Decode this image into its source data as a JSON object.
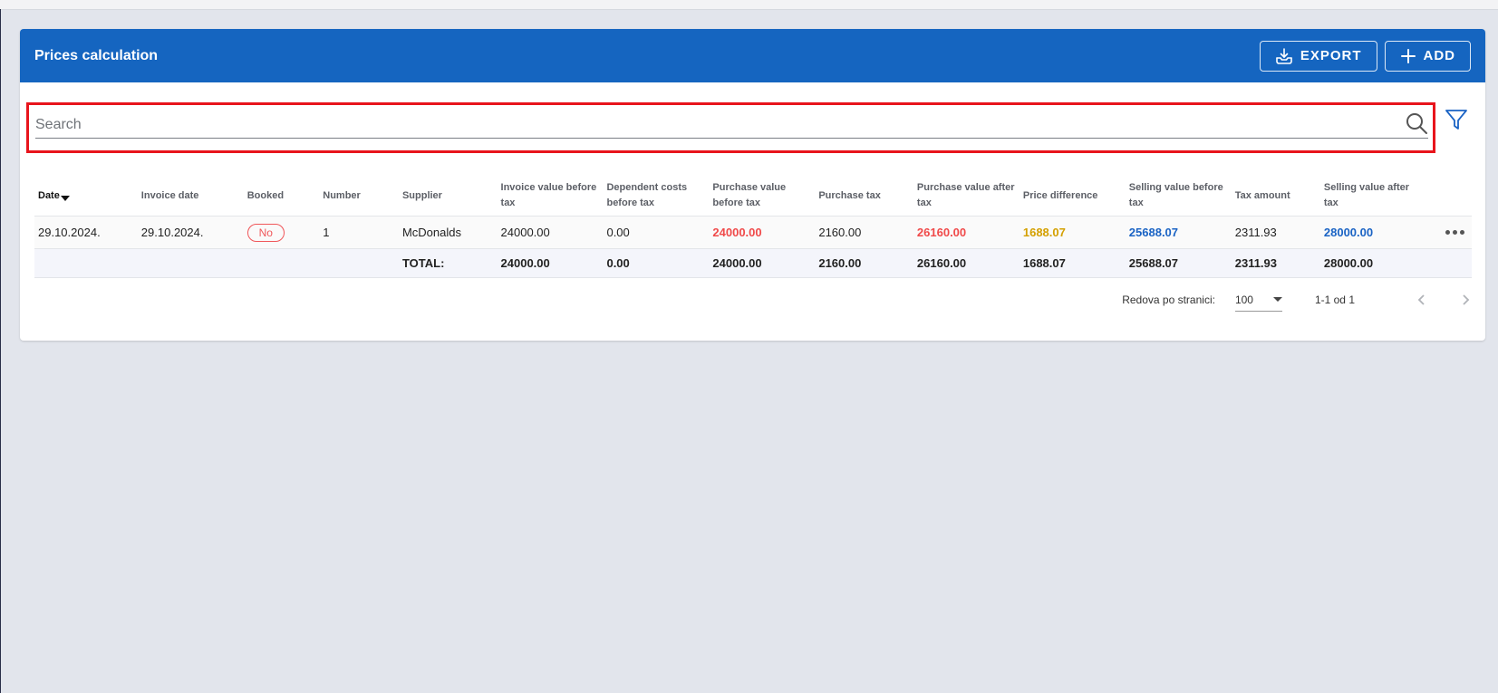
{
  "header": {
    "title": "Prices calculation",
    "export_label": "EXPORT",
    "add_label": "ADD"
  },
  "search": {
    "placeholder": "Search",
    "value": ""
  },
  "icons": {
    "export": "download-icon",
    "add": "plus-icon",
    "search": "search-icon",
    "filter": "filter-icon",
    "row_menu": "more-horizontal-icon",
    "prev": "chevron-left-icon",
    "next": "chevron-right-icon"
  },
  "colors": {
    "header_bg": "#1565c0",
    "negative": "#f04a4a",
    "difference": "#d4a000",
    "selling": "#1a63c4",
    "highlight_border": "#e8141c"
  },
  "table": {
    "columns": [
      "Date",
      "Invoice date",
      "Booked",
      "Number",
      "Supplier",
      "Invoice value before tax",
      "Dependent costs before tax",
      "Purchase value before tax",
      "Purchase tax",
      "Purchase value after tax",
      "Price difference",
      "Selling value before tax",
      "Tax amount",
      "Selling value after tax"
    ],
    "rows": [
      {
        "date": "29.10.2024.",
        "invoice_date": "29.10.2024.",
        "booked": "No",
        "number": "1",
        "supplier": "McDonalds",
        "invoice_value_before_tax": "24000.00",
        "dependent_costs_before_tax": "0.00",
        "purchase_value_before_tax": "24000.00",
        "purchase_tax": "2160.00",
        "purchase_value_after_tax": "26160.00",
        "price_difference": "1688.07",
        "selling_value_before_tax": "25688.07",
        "tax_amount": "2311.93",
        "selling_value_after_tax": "28000.00"
      }
    ],
    "total": {
      "label": "TOTAL:",
      "invoice_value_before_tax": "24000.00",
      "dependent_costs_before_tax": "0.00",
      "purchase_value_before_tax": "24000.00",
      "purchase_tax": "2160.00",
      "purchase_value_after_tax": "26160.00",
      "price_difference": "1688.07",
      "selling_value_before_tax": "25688.07",
      "tax_amount": "2311.93",
      "selling_value_after_tax": "28000.00"
    }
  },
  "pagination": {
    "rows_label": "Redova po stranici:",
    "rows_value": "100",
    "range": "1-1 od 1"
  }
}
